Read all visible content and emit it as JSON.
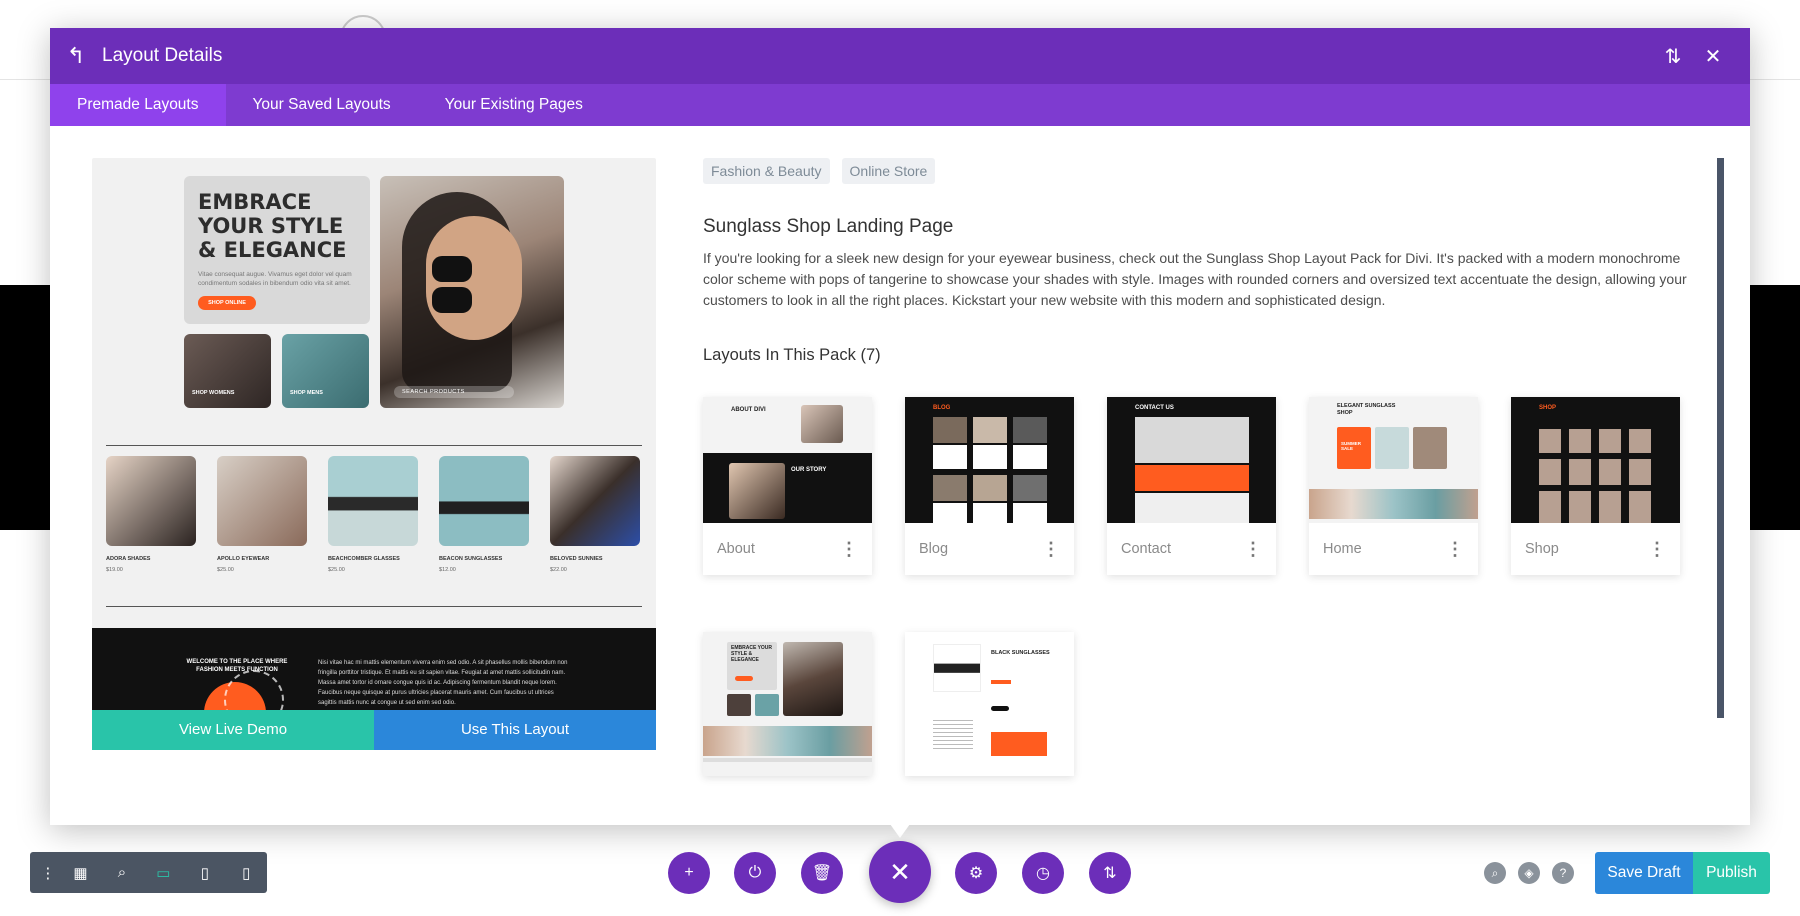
{
  "modal": {
    "title": "Layout Details",
    "tabs": [
      {
        "label": "Premade Layouts",
        "active": true
      },
      {
        "label": "Your Saved Layouts",
        "active": false
      },
      {
        "label": "Your Existing Pages",
        "active": false
      }
    ]
  },
  "preview": {
    "headline": "EMBRACE YOUR STYLE & ELEGANCE",
    "body": "Vitae consequat augue. Vivamus eget dolor vel quam condimentum sodales in bibendum odio vita sit amet.",
    "shop_button": "SHOP ONLINE",
    "shop_womens": "SHOP WOMENS",
    "shop_mens": "SHOP MENS",
    "search": "SEARCH PRODUCTS",
    "products": [
      {
        "name": "ADORA SHADES",
        "price": "$19.00"
      },
      {
        "name": "APOLLO EYEWEAR",
        "price": "$25.00"
      },
      {
        "name": "BEACHCOMBER GLASSES",
        "price": "$25.00"
      },
      {
        "name": "BEACON SUNGLASSES",
        "price": "$12.00"
      },
      {
        "name": "BELOVED SUNNIES",
        "price": "$22.00"
      }
    ],
    "dark_title": "WELCOME TO THE PLACE WHERE FASHION MEETS FUNCTION",
    "dark_text": "Nisi vitae hac mi mattis elementum viverra enim sed odio. A sit phasellus mollis bibendum non fringilla porttitor tristique. Et mattis eu sit sapien vitae. Feugiat at amet mattis sollicitudin nam. Massa amet tortor id ornare congue quis id ac. Adipiscing fermentum blandit neque lorem. Faucibus neque quisque at purus ultricies placerat mauris amet. Cum faucibus ut ultrices sagittis mattis nunc at congue ut sed enim sed odio.",
    "view_demo": "View Live Demo",
    "use_layout": "Use This Layout"
  },
  "details": {
    "tags": [
      "Fashion & Beauty",
      "Online Store"
    ],
    "title": "Sunglass Shop Landing Page",
    "description": "If you're looking for a sleek new design for your eyewear business, check out the Sunglass Shop Layout Pack for Divi. It's packed with a modern monochrome color scheme with pops of tangerine to showcase your shades with style. Images with rounded corners and oversized text accentuate the design, allowing your customers to look in all the right places. Kickstart your new website with this modern and sophisticated design.",
    "pack_heading": "Layouts In This Pack (7)",
    "layouts": [
      {
        "label": "About",
        "thumb_text": "ABOUT DIVI",
        "thumb_sub": "OUR STORY"
      },
      {
        "label": "Blog",
        "thumb_text": "BLOG"
      },
      {
        "label": "Contact",
        "thumb_text": "CONTACT US"
      },
      {
        "label": "Home",
        "thumb_text": "ELEGANT SUNGLASS SHOP",
        "thumb_sub": "SUMMER SALE"
      },
      {
        "label": "Shop",
        "thumb_text": "SHOP"
      },
      {
        "label": "",
        "thumb_text": "EMBRACE YOUR STYLE & ELEGANCE"
      },
      {
        "label": "",
        "thumb_text": "BLACK SUNGLASSES"
      }
    ]
  },
  "toolbar": {
    "save_draft": "Save Draft",
    "publish": "Publish"
  },
  "colors": {
    "purple": "#6c2eb9",
    "tab_bar": "#7e3bd0",
    "active_tab": "#8f42ec",
    "teal": "#29c4a9",
    "blue": "#2b87da",
    "tangerine": "#ff5c1f"
  }
}
